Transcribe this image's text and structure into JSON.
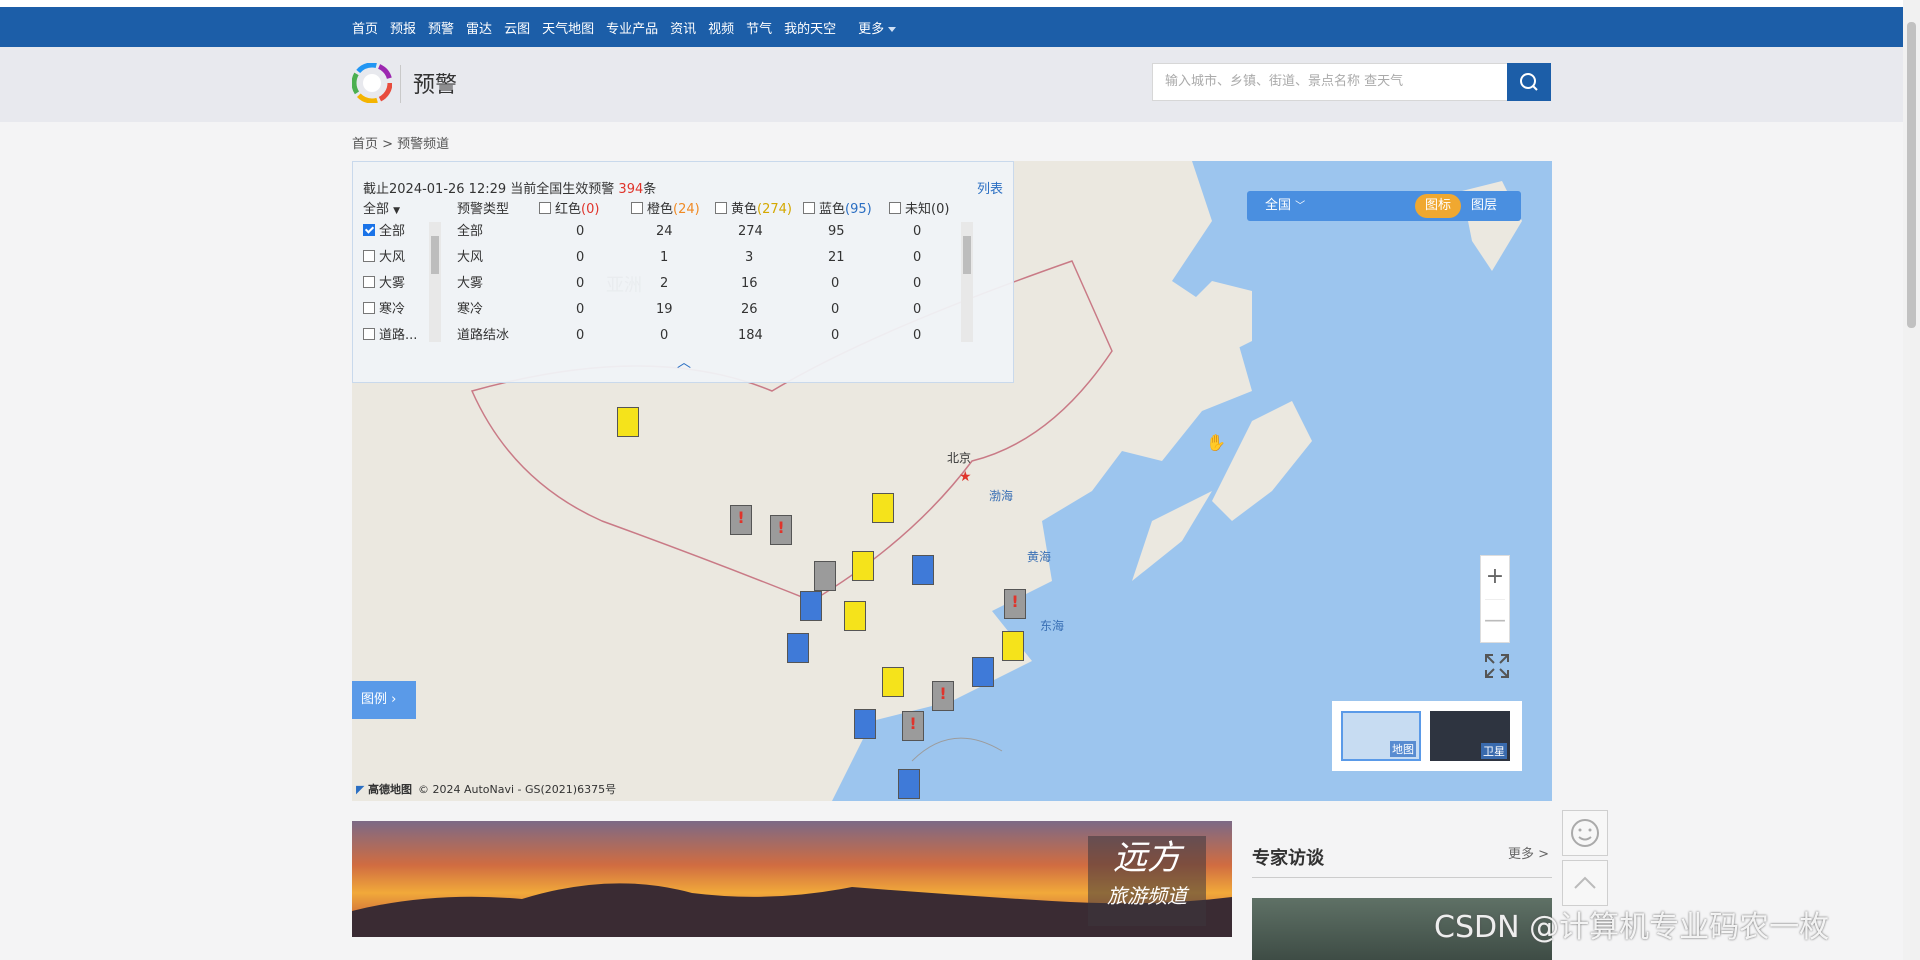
{
  "nav": {
    "items": [
      "首页",
      "预报",
      "预警",
      "雷达",
      "云图",
      "天气地图",
      "专业产品",
      "资讯",
      "视频",
      "节气",
      "我的天空"
    ],
    "more": "更多"
  },
  "header": {
    "title": "预警",
    "search_placeholder": "输入城市、乡镇、街道、景点名称 查天气"
  },
  "breadcrumb": "首页 > 预警频道",
  "panel": {
    "head_prefix": "截止2024-01-26 12:29 当前全国生效预警 ",
    "total": "394",
    "head_suffix": "条",
    "list_link": "列表",
    "filter_all": "全部",
    "type_header": "预警类型",
    "levels": [
      {
        "label": "红色",
        "count": "(0)",
        "color": "#e0342b"
      },
      {
        "label": "橙色",
        "count": "(24)",
        "color": "#f08a24"
      },
      {
        "label": "黄色",
        "count": "(274)",
        "color": "#d4a800"
      },
      {
        "label": "蓝色",
        "count": "(95)",
        "color": "#2a6ec2"
      },
      {
        "label": "未知",
        "count": "(0)",
        "color": "#333333"
      }
    ],
    "rows": [
      {
        "check": "全部",
        "type": "全部",
        "values": [
          "0",
          "24",
          "274",
          "95",
          "0"
        ],
        "checked": true
      },
      {
        "check": "大风",
        "type": "大风",
        "values": [
          "0",
          "1",
          "3",
          "21",
          "0"
        ],
        "checked": false
      },
      {
        "check": "大雾",
        "type": "大雾",
        "values": [
          "0",
          "2",
          "16",
          "0",
          "0"
        ],
        "checked": false
      },
      {
        "check": "寒冷",
        "type": "寒冷",
        "values": [
          "0",
          "19",
          "26",
          "0",
          "0"
        ],
        "checked": false
      },
      {
        "check": "道路...",
        "type": "道路结冰",
        "values": [
          "0",
          "0",
          "184",
          "0",
          "0"
        ],
        "checked": false
      }
    ]
  },
  "map": {
    "region": "全国",
    "btn_icon": "图标",
    "btn_layer": "图层",
    "legend": "图例",
    "labels": {
      "asia": "亚洲",
      "beijing": "北京",
      "bohai": "渤海",
      "huanghai": "黄海",
      "donghai": "东海"
    },
    "layer_map": "地图",
    "layer_sat": "卫星",
    "footer_brand": "高德地图",
    "footer_copy": "© 2024 AutoNavi - GS(2021)6375号",
    "zoom_in": "+",
    "zoom_out": "—"
  },
  "banner": {
    "line1": "远方",
    "line2": "旅游频道"
  },
  "expert": {
    "title": "专家访谈",
    "more": "更多 >"
  },
  "watermark": "CSDN @计算机专业码农一枚",
  "colors": {
    "nav": "#1c5ea8",
    "accent": "#f0a830",
    "warning_red": "#e0342b"
  }
}
